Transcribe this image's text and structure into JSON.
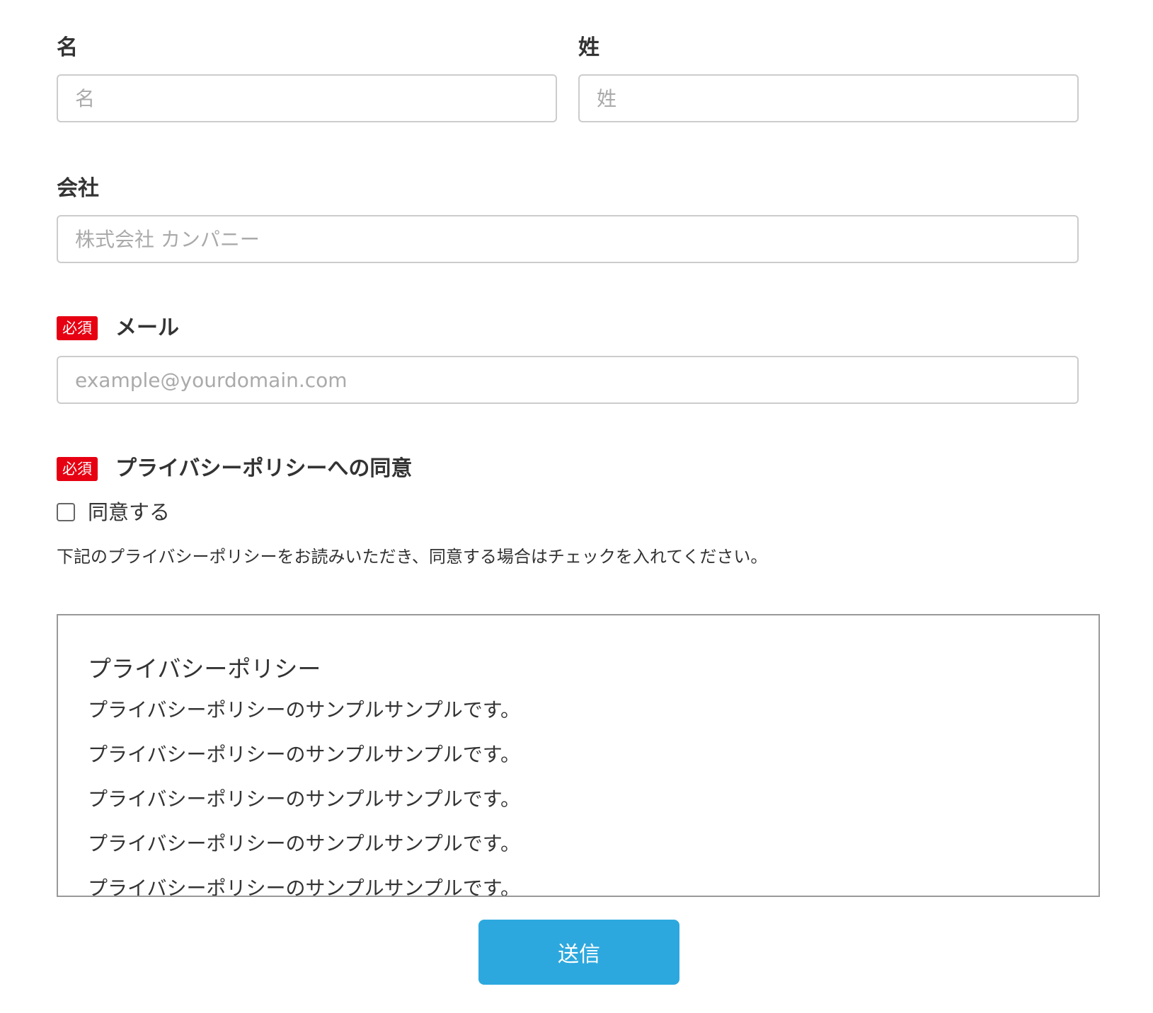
{
  "form": {
    "first_name": {
      "label": "名",
      "placeholder": "名"
    },
    "last_name": {
      "label": "姓",
      "placeholder": "姓"
    },
    "company": {
      "label": "会社",
      "placeholder": "株式会社 カンパニー"
    },
    "email": {
      "required_badge": "必須",
      "label": "メール",
      "placeholder": "example@yourdomain.com"
    },
    "privacy": {
      "required_badge": "必須",
      "label": "プライバシーポリシーへの同意",
      "checkbox_label": "同意する",
      "help_text": "下記のプライバシーポリシーをお読みいただき、同意する場合はチェックを入れてください。"
    },
    "policy_box": {
      "title": "プライバシーポリシー",
      "lines": [
        "プライバシーポリシーのサンプルサンプルです。",
        "プライバシーポリシーのサンプルサンプルです。",
        "プライバシーポリシーのサンプルサンプルです。",
        "プライバシーポリシーのサンプルサンプルです。",
        "プライバシーポリシーのサンプルサンプルです。"
      ]
    },
    "submit_label": "送信"
  },
  "colors": {
    "required_badge": "#e60012",
    "submit_button": "#2da8de",
    "input_border": "#cccccc",
    "placeholder": "#aaaaaa",
    "text": "#333333"
  }
}
